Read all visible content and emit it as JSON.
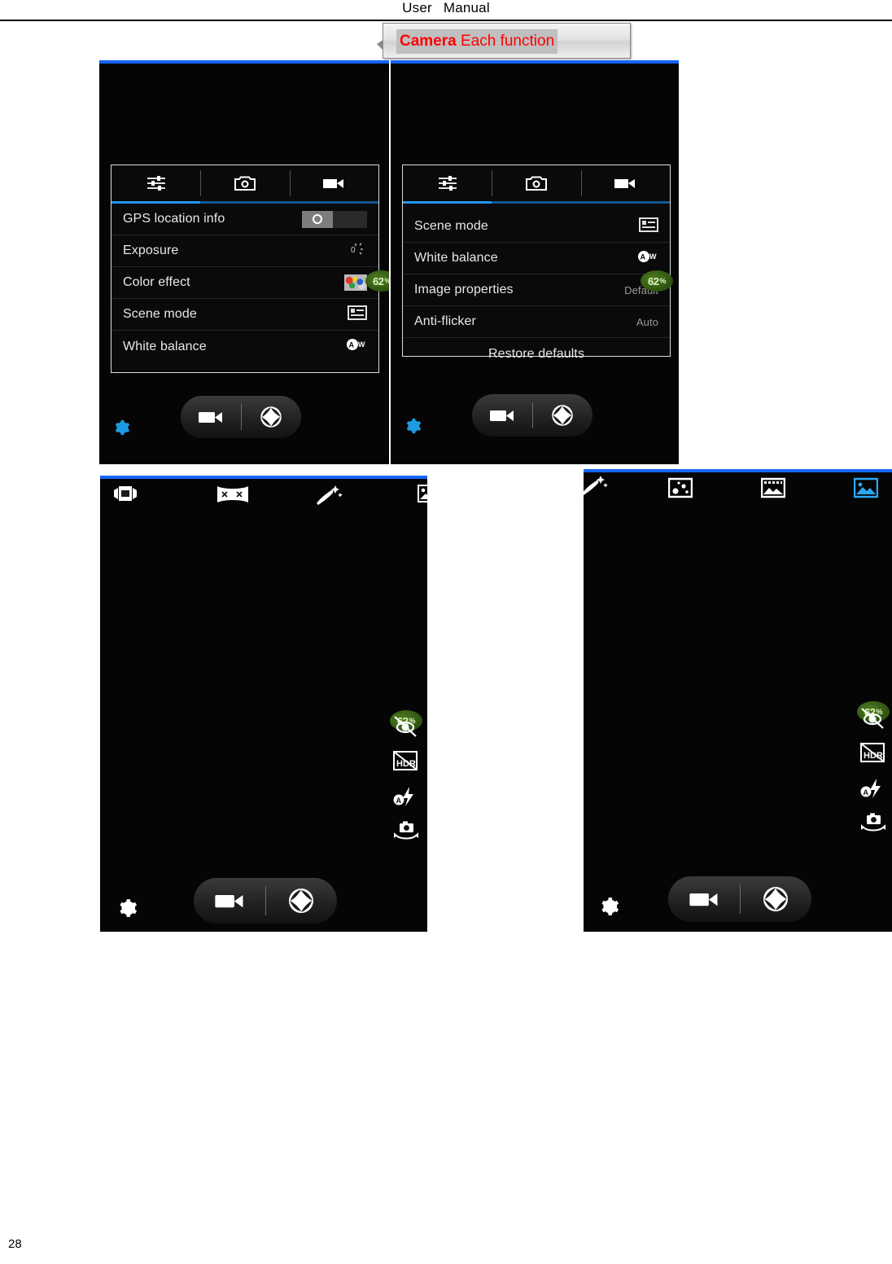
{
  "document": {
    "header_left": "User",
    "header_right": "Manual",
    "page_number": "28"
  },
  "callout": {
    "bold_text": "Camera",
    "normal_text": " Each function",
    "text_color": "#ff0000",
    "box_fill": "#d3d3d3",
    "highlight_fill": "#bfbfbf"
  },
  "colors": {
    "accent_blue": "#1565ff",
    "tab_blue": "#2196f3",
    "battery_green": "#3f6a18",
    "screen_black": "#050505"
  },
  "screenshots": [
    {
      "id": "settings-general",
      "tabs": [
        {
          "name": "general-settings-tab",
          "icon": "sliders-icon",
          "active": true
        },
        {
          "name": "photo-settings-tab",
          "icon": "camera-icon",
          "active": false
        },
        {
          "name": "video-settings-tab",
          "icon": "video-camera-icon",
          "active": false
        }
      ],
      "rows": [
        {
          "label": "GPS location info",
          "control": "toggle",
          "value": "off"
        },
        {
          "label": "Exposure",
          "control": "icon",
          "icon": "exposure-icon",
          "value": ""
        },
        {
          "label": "Color effect",
          "control": "swatch",
          "icon": "color-effect-icon",
          "value": ""
        },
        {
          "label": "Scene mode",
          "control": "icon",
          "icon": "scene-mode-icon",
          "value": ""
        },
        {
          "label": "White balance",
          "control": "icon",
          "icon": "white-balance-auto-icon",
          "value": ""
        }
      ],
      "battery": {
        "value": "62",
        "unit": "%"
      },
      "bottom_bar": {
        "settings_icon": "gear-icon",
        "settings_icon_color": "#1e9be0",
        "video_button_icon": "video-camera-icon",
        "shutter_button_icon": "shutter-aperture-icon"
      }
    },
    {
      "id": "settings-general-scrolled",
      "tabs": [
        {
          "name": "general-settings-tab",
          "icon": "sliders-icon",
          "active": true
        },
        {
          "name": "photo-settings-tab",
          "icon": "camera-icon",
          "active": false
        },
        {
          "name": "video-settings-tab",
          "icon": "video-camera-icon",
          "active": false
        }
      ],
      "rows": [
        {
          "label": "Scene mode",
          "control": "icon",
          "icon": "scene-mode-icon",
          "value": ""
        },
        {
          "label": "White balance",
          "control": "icon",
          "icon": "white-balance-auto-icon",
          "value": ""
        },
        {
          "label": "Image properties",
          "control": "text",
          "value": "Default"
        },
        {
          "label": "Anti-flicker",
          "control": "text",
          "value": "Auto"
        },
        {
          "label": "Restore defaults",
          "control": "center",
          "value": ""
        }
      ],
      "battery": {
        "value": "62",
        "unit": "%"
      },
      "bottom_bar": {
        "settings_icon": "gear-icon",
        "settings_icon_color": "#1e9be0",
        "video_button_icon": "video-camera-icon",
        "shutter_button_icon": "shutter-aperture-icon"
      }
    },
    {
      "id": "camera-modes-left",
      "mode_icons": [
        {
          "name": "multi-angle-view-icon",
          "selected": false
        },
        {
          "name": "panorama-icon",
          "selected": false
        },
        {
          "name": "magic-wand-icon",
          "selected": false
        },
        {
          "name": "normal-photo-icon",
          "selected": false
        }
      ],
      "side_controls": [
        {
          "name": "gps-off-icon",
          "label": "GPS off"
        },
        {
          "name": "hdr-off-icon",
          "label": "HDR"
        },
        {
          "name": "flash-auto-icon",
          "label": "Flash auto"
        },
        {
          "name": "switch-camera-icon",
          "label": "Switch camera"
        }
      ],
      "battery": {
        "value": "62",
        "unit": "%"
      },
      "bottom_bar": {
        "settings_icon": "gear-icon",
        "settings_icon_color": "#ffffff",
        "video_button_icon": "video-camera-icon",
        "shutter_button_icon": "shutter-aperture-icon"
      }
    },
    {
      "id": "camera-modes-right",
      "mode_icons": [
        {
          "name": "magic-wand-icon",
          "selected": false
        },
        {
          "name": "multi-shot-icon",
          "selected": false
        },
        {
          "name": "film-strip-icon",
          "selected": false
        },
        {
          "name": "normal-photo-icon",
          "selected": true
        }
      ],
      "side_controls": [
        {
          "name": "gps-off-icon",
          "label": "GPS off"
        },
        {
          "name": "hdr-off-icon",
          "label": "HDR"
        },
        {
          "name": "flash-auto-icon",
          "label": "Flash auto"
        },
        {
          "name": "switch-camera-icon",
          "label": "Switch camera"
        }
      ],
      "battery": {
        "value": "62",
        "unit": "%"
      },
      "bottom_bar": {
        "settings_icon": "gear-icon",
        "settings_icon_color": "#ffffff",
        "video_button_icon": "video-camera-icon",
        "shutter_button_icon": "shutter-aperture-icon"
      }
    }
  ]
}
